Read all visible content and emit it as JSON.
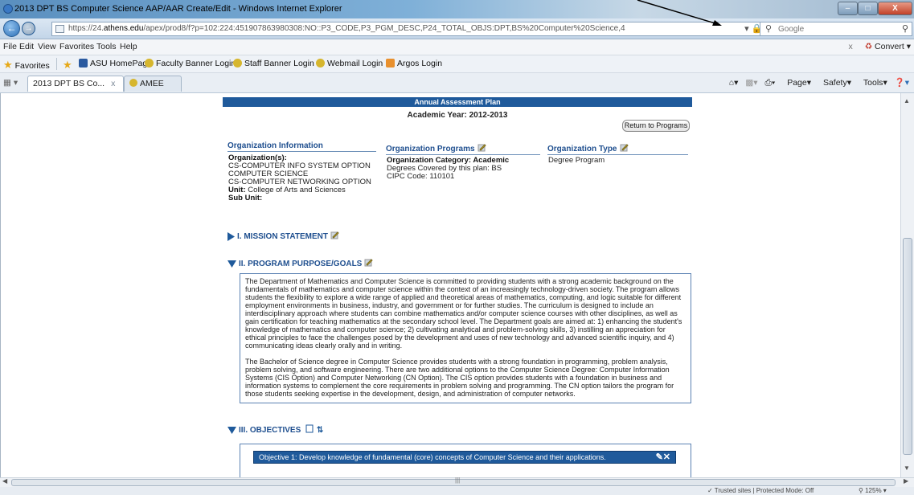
{
  "window": {
    "title": "2013 DPT BS Computer Science AAP/AAR Create/Edit - Windows Internet Explorer",
    "min": "–",
    "max": "□",
    "close": "X"
  },
  "address": {
    "url_prefix": "https://24.",
    "url_host": "athens.edu",
    "url_path": "/apex/prod8/f?p=102:224:451907863980308:NO::P3_CODE,P3_PGM_DESC,P24_TOTAL_OBJS:DPT,BS%20Computer%20Science,4",
    "search_placeholder": "Google"
  },
  "menu": {
    "items": [
      "File",
      "Edit",
      "View",
      "Favorites",
      "Tools",
      "Help"
    ],
    "right": "Convert"
  },
  "favorites": {
    "label": "Favorites",
    "links": [
      "ASU HomePage",
      "Faculty Banner Login",
      "Staff Banner Login",
      "Webmail Login",
      "Argos Login"
    ]
  },
  "tabs": [
    {
      "label": "2013 DPT BS Co..."
    },
    {
      "label": "AMEE"
    }
  ],
  "commandbar": [
    "Page",
    "Safety",
    "Tools"
  ],
  "page": {
    "header": "Annual Assessment Plan",
    "academic_year": "Academic Year: 2012-2013",
    "return_button": "Return to Programs",
    "org_info": {
      "heading": "Organization Information",
      "orgs_label": "Organization(s):",
      "orgs": [
        "CS-COMPUTER INFO SYSTEM OPTION",
        "COMPUTER SCIENCE",
        "CS-COMPUTER NETWORKING OPTION"
      ],
      "unit_label": "Unit:",
      "unit": "College of Arts and Sciences",
      "subunit_label": "Sub Unit:"
    },
    "org_programs": {
      "heading": "Organization Programs",
      "category_label": "Organization Category: Academic",
      "degrees": "Degrees Covered by this plan: BS",
      "cipc": "CIPC Code: 110101"
    },
    "org_type": {
      "heading": "Organization Type",
      "value": "Degree Program"
    },
    "mission_heading": "I. MISSION STATEMENT",
    "purpose_heading": "II. PROGRAM PURPOSE/GOALS",
    "purpose_p1": "The Department of Mathematics and Computer Science is committed to providing students with a strong academic background on the fundamentals of mathematics and computer science within the context of an increasingly technology-driven society. The program allows students the flexibility to explore a wide range of applied and theoretical areas of mathematics, computing, and logic suitable for different employment environments in business, industry, and government or for further studies. The curriculum is designed to include an interdisciplinary approach where students can combine mathematics and/or computer science courses with other disciplines, as well as gain certification for teaching mathematics at the secondary school level. The Department goals are aimed at: 1) enhancing the student's knowledge of mathematics and computer science; 2) cultivating analytical and problem-solving skills, 3) instilling an appreciation for ethical principles to face the challenges posed by the development and uses of new technology and advanced scientific inquiry, and 4) communicating ideas clearly orally and in writing.",
    "purpose_p2": "The Bachelor of Science degree in Computer Science provides students with a strong foundation in programming, problem analysis, problem solving, and software engineering. There are two additional options to the Computer Science Degree: Computer Information Systems (CIS Option) and Computer Networking (CN Option). The CIS option provides students with a foundation in business and information systems to complement the core requirements in problem solving and programming. The CN option tailors the program for those students seeking expertise in the development, design, and administration of computer networks.",
    "objectives_heading": "III. OBJECTIVES",
    "objective_1": "Objective 1: Develop knowledge of fundamental (core) concepts of Computer Science and their applications."
  },
  "status": {
    "zone": "Trusted sites | Protected Mode: Off",
    "zoom": "125%"
  },
  "colors": {
    "accent": "#1f5a9b",
    "heading": "#1f4f8f"
  }
}
